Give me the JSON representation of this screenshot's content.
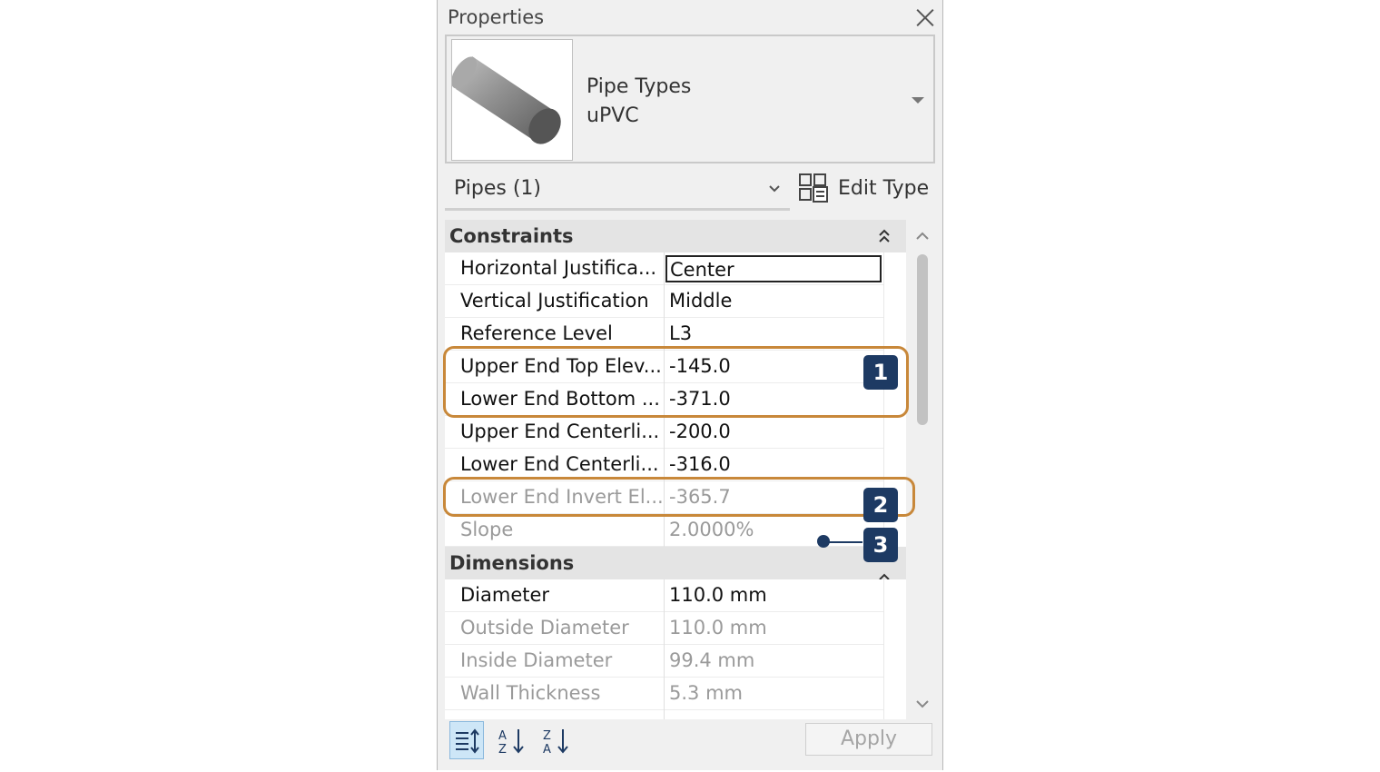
{
  "panel": {
    "title": "Properties",
    "type_selector": {
      "line1": "Pipe Types",
      "line2": "uPVC"
    },
    "filter": {
      "label": "Pipes (1)"
    },
    "edit_type_label": "Edit Type",
    "apply_label": "Apply"
  },
  "sections": {
    "constraints": {
      "title": "Constraints",
      "rows": [
        {
          "label": "Horizontal Justifica...",
          "value": "Center"
        },
        {
          "label": "Vertical Justification",
          "value": "Middle"
        },
        {
          "label": "Reference Level",
          "value": "L3"
        },
        {
          "label": "Upper End Top Elev...",
          "value": "-145.0"
        },
        {
          "label": "Lower End Bottom ...",
          "value": "-371.0"
        },
        {
          "label": "Upper End Centerli...",
          "value": "-200.0"
        },
        {
          "label": "Lower End Centerli...",
          "value": "-316.0"
        },
        {
          "label": "Lower End Invert El...",
          "value": "-365.7"
        },
        {
          "label": "Slope",
          "value": "2.0000%"
        }
      ]
    },
    "dimensions": {
      "title": "Dimensions",
      "rows": [
        {
          "label": "Diameter",
          "value": "110.0 mm"
        },
        {
          "label": "Outside Diameter",
          "value": "110.0 mm"
        },
        {
          "label": "Inside Diameter",
          "value": "99.4 mm"
        },
        {
          "label": "Wall Thickness",
          "value": "5.3 mm"
        }
      ]
    }
  },
  "annotations": {
    "badge1": "1",
    "badge2": "2",
    "badge3": "3"
  },
  "colors": {
    "highlight": "#c8883a",
    "badge": "#1d3a63",
    "sort_active": "#cde6f7"
  },
  "icons": [
    "close-icon",
    "pipe-thumbnail",
    "dropdown-arrow-icon",
    "edit-type-icon",
    "collapse-icon",
    "scroll-up-icon",
    "scroll-down-icon",
    "sort-categorized-icon",
    "sort-ascending-icon",
    "sort-descending-icon"
  ]
}
